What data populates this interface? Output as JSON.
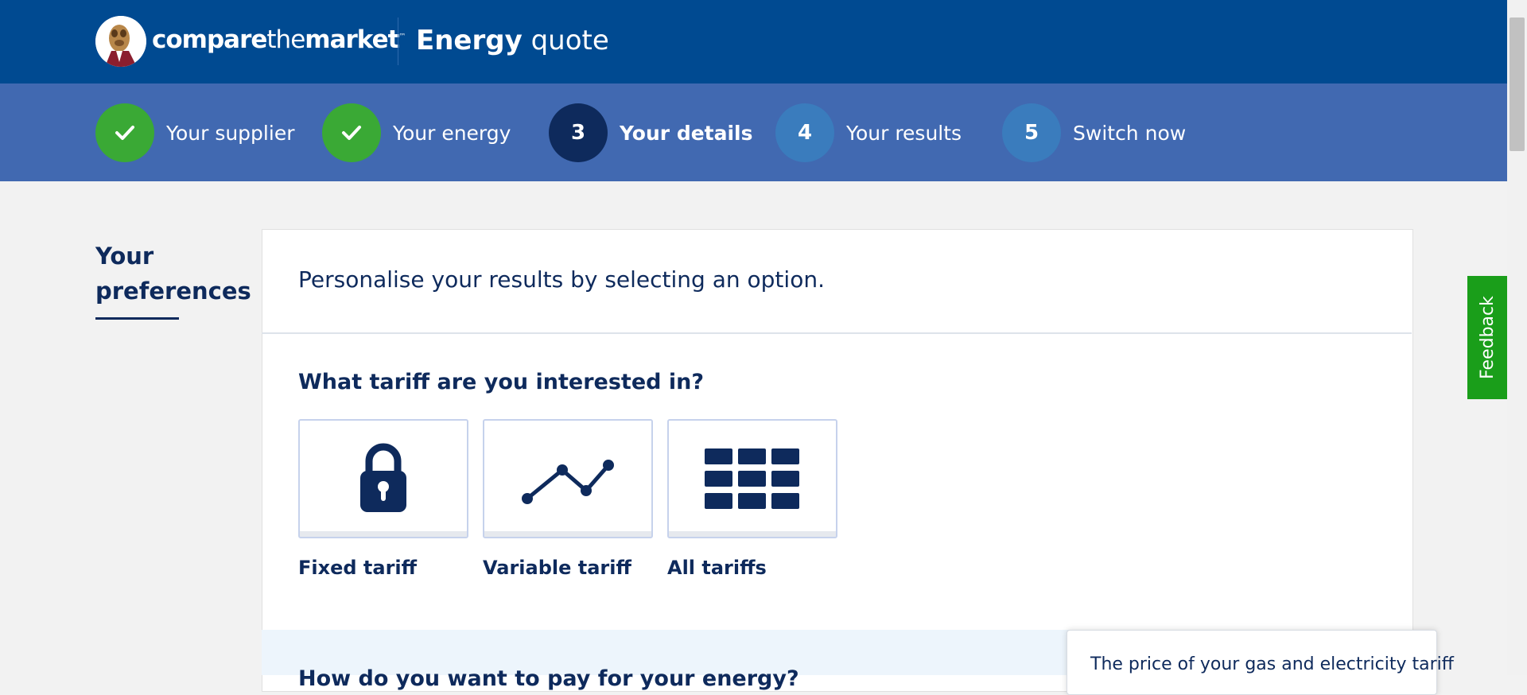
{
  "header": {
    "logo_parts": {
      "bold1": "compare",
      "light": "the",
      "bold2": "market",
      "tm": "™"
    },
    "title_bold": "Energy",
    "title_rest": "quote"
  },
  "progress": {
    "steps": [
      {
        "number": "",
        "label": "Your supplier",
        "state": "done"
      },
      {
        "number": "",
        "label": "Your energy",
        "state": "done"
      },
      {
        "number": "3",
        "label": "Your details",
        "state": "current"
      },
      {
        "number": "4",
        "label": "Your results",
        "state": "future"
      },
      {
        "number": "5",
        "label": "Switch now",
        "state": "future"
      }
    ]
  },
  "sidebar": {
    "heading_line1": "Your",
    "heading_line2": "preferences"
  },
  "main": {
    "intro": "Personalise your results by selecting an option.",
    "question": "What tariff are you interested in?",
    "options": [
      {
        "label": "Fixed tariff",
        "icon": "padlock-icon"
      },
      {
        "label": "Variable tariff",
        "icon": "line-graph-icon"
      },
      {
        "label": "All tariffs",
        "icon": "grid-icon"
      }
    ],
    "next_question": "How do you want to pay for your energy?"
  },
  "tooltip": {
    "text": "The price of your gas and electricity tariff"
  },
  "feedback": {
    "label": "Feedback"
  },
  "colors": {
    "header": "#004a91",
    "progress_bar": "#4169b1",
    "done": "#3aa935",
    "current": "#0e2a5c",
    "future": "#3a7cbd",
    "feedback": "#1a9e1a",
    "text": "#0e2a5c"
  }
}
